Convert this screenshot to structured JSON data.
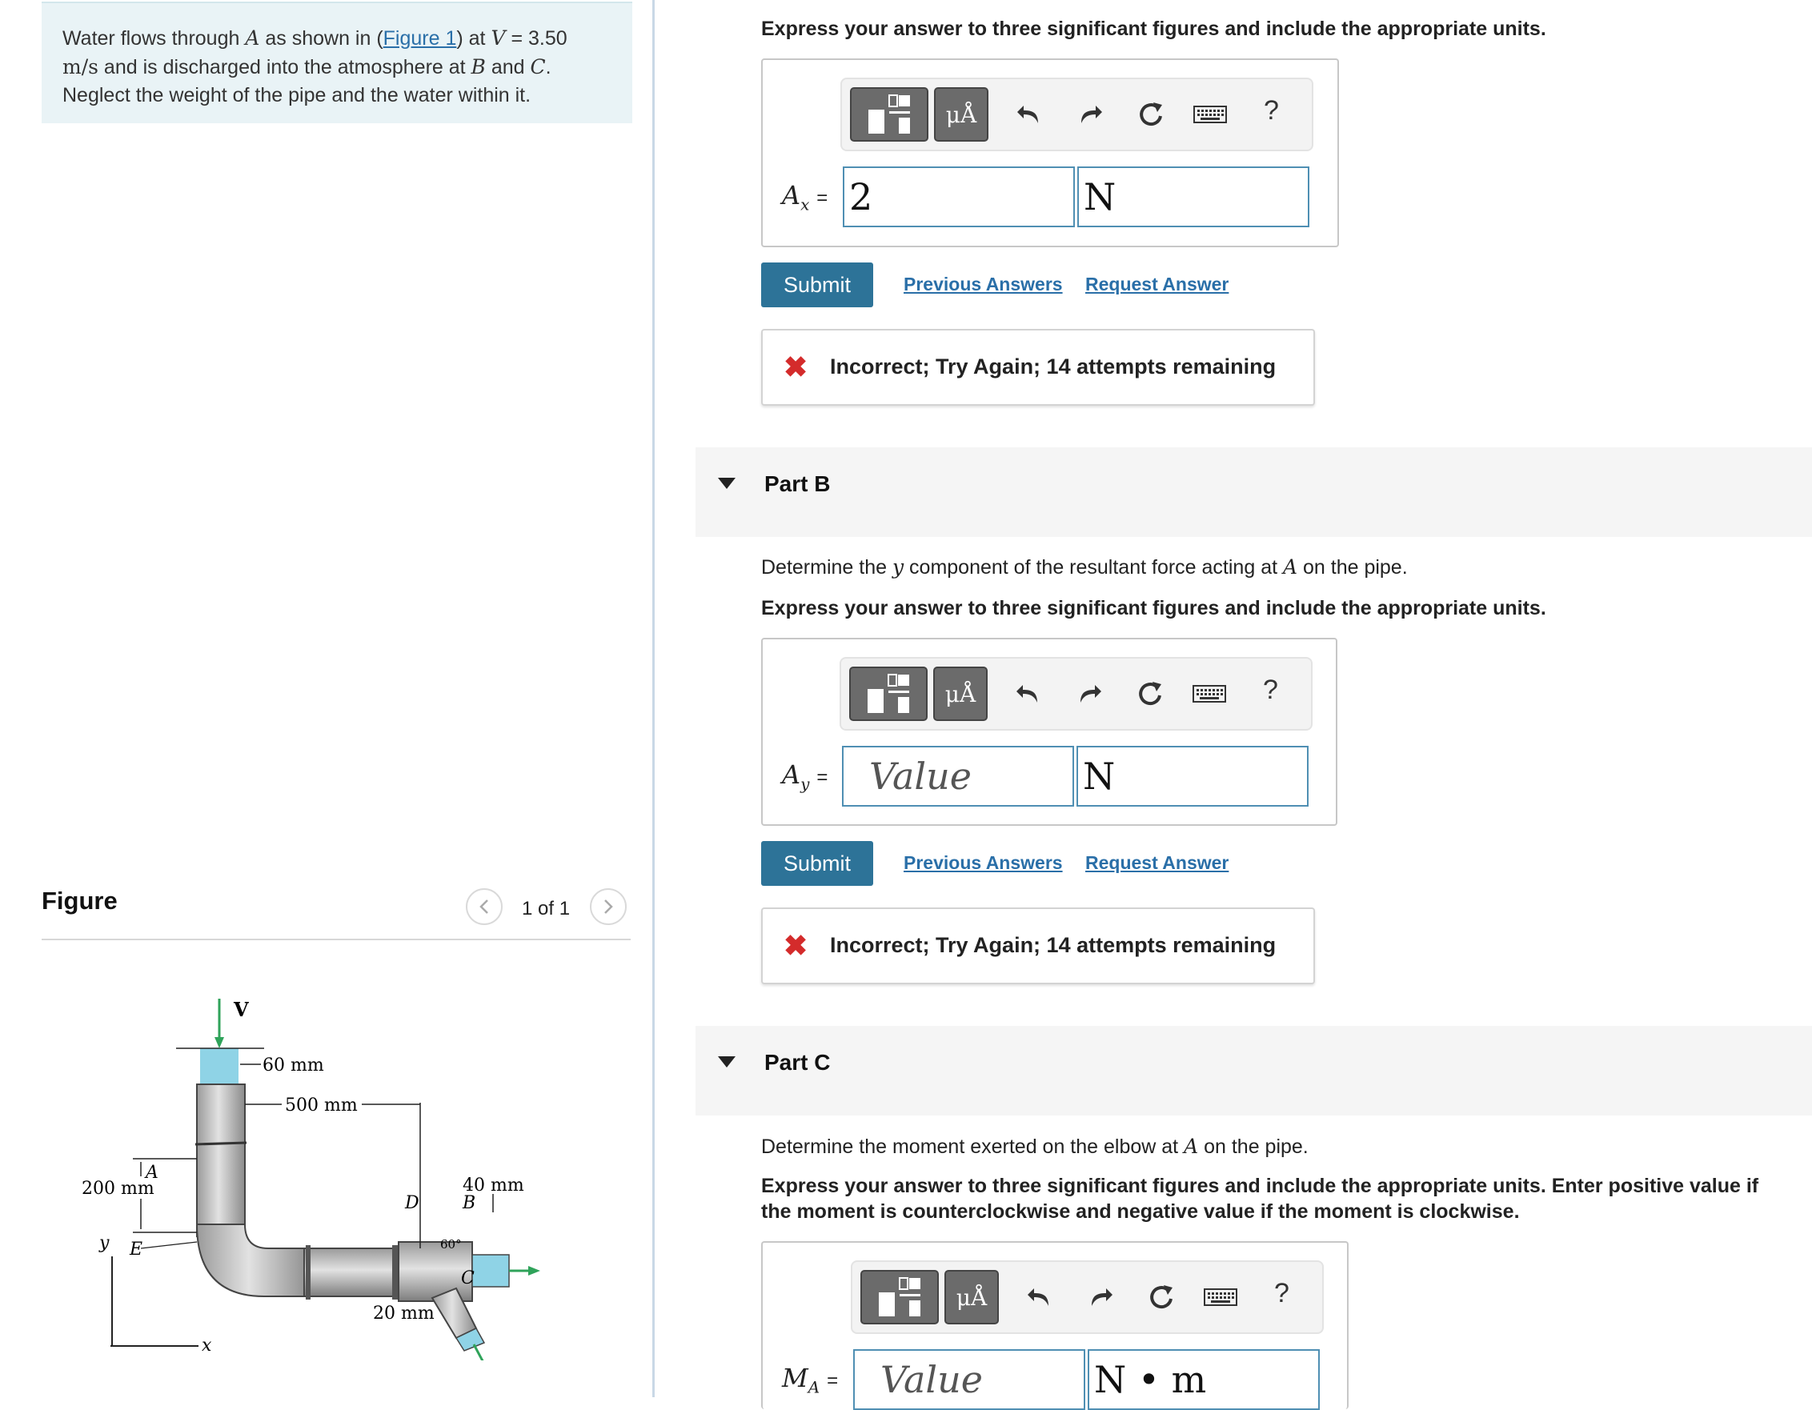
{
  "problem": {
    "text_a": "Water flows through ",
    "var_A": "A",
    "text_b": " as shown in (",
    "figure_link": "Figure 1",
    "text_c": ") at ",
    "var_V": "V",
    "text_d": " = 3.50",
    "unit": "m/s",
    "text_e": " and is discharged into the atmosphere at ",
    "var_B": "B",
    "text_f": " and ",
    "var_C": "C",
    "text_g": ".",
    "line3": "Neglect the weight of the pipe and the water within it."
  },
  "figure": {
    "heading": "Figure",
    "counter": "1 of 1",
    "labels": {
      "v": "V",
      "d60": "60 mm",
      "d500": "500 mm",
      "a": "A",
      "d200": "200 mm",
      "d40": "40 mm",
      "b": "B",
      "d": "D",
      "angle": "60°",
      "c": "C",
      "e": "E",
      "d20": "20 mm",
      "y": "y",
      "x": "x"
    }
  },
  "partA": {
    "instruction": "Express your answer to three significant figures and include the appropriate units.",
    "var_main": "A",
    "var_sub": "x",
    "equals": "=",
    "value": "2",
    "unit": "N",
    "submit": "Submit",
    "previous": "Previous Answers",
    "request": "Request Answer",
    "feedback": "Incorrect; Try Again; 14 attempts remaining"
  },
  "partB": {
    "title": "Part B",
    "q_a": "Determine the ",
    "q_var": "y",
    "q_b": " component of the resultant force acting at ",
    "q_var2": "A",
    "q_c": " on the pipe.",
    "instruction": "Express your answer to three significant figures and include the appropriate units.",
    "var_main": "A",
    "var_sub": "y",
    "equals": "=",
    "placeholder": "Value",
    "unit": "N",
    "submit": "Submit",
    "previous": "Previous Answers",
    "request": "Request Answer",
    "feedback": "Incorrect; Try Again; 14 attempts remaining"
  },
  "partC": {
    "title": "Part C",
    "q_a": "Determine the moment exerted on the elbow at ",
    "q_var": "A",
    "q_b": " on the pipe.",
    "instruction_1": "Express your answer to three significant figures and include the appropriate units. Enter positive value if",
    "instruction_2": "the moment is counterclockwise and negative value if the moment is clockwise.",
    "var_main": "M",
    "var_sub": "A",
    "equals": "=",
    "placeholder": "Value",
    "unit": "N • m"
  },
  "toolbar": {
    "units_label": "μÅ",
    "help": "?"
  },
  "colors": {
    "accent": "#2d7398",
    "link": "#2a6fa8",
    "error": "#d42b2b",
    "problem_bg": "#e9f3f6",
    "water": "#8fd3e6",
    "arrow_green": "#2fa35a"
  }
}
